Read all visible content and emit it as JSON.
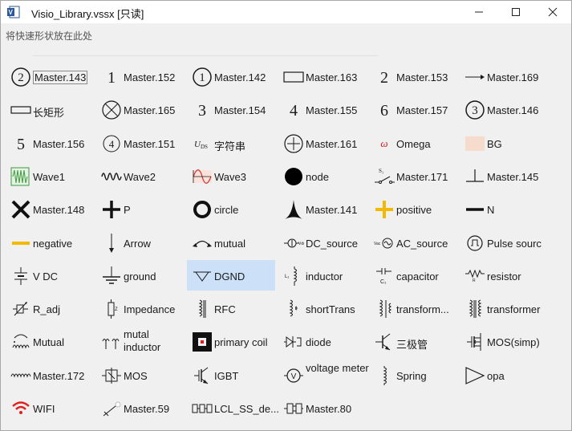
{
  "window": {
    "title": "Visio_Library.vssx  [只读]"
  },
  "hint_text": "将快速形状放在此处",
  "shapes": [
    {
      "label": "Master.143",
      "icon": "circled-two-icon"
    },
    {
      "label": "Master.152",
      "icon": "numeral-one-icon"
    },
    {
      "label": "Master.142",
      "icon": "circled-one-icon"
    },
    {
      "label": "Master.163",
      "icon": "rectangle-icon"
    },
    {
      "label": "Master.153",
      "icon": "numeral-two-icon"
    },
    {
      "label": "Master.169",
      "icon": "arrow-right-icon"
    },
    {
      "label": "长矩形",
      "icon": "long-rectangle-icon"
    },
    {
      "label": "Master.165",
      "icon": "circle-cross-icon"
    },
    {
      "label": "Master.154",
      "icon": "numeral-three-icon"
    },
    {
      "label": "Master.155",
      "icon": "numeral-four-icon"
    },
    {
      "label": "Master.157",
      "icon": "numeral-six-icon"
    },
    {
      "label": "Master.146",
      "icon": "circled-three-icon"
    },
    {
      "label": "Master.156",
      "icon": "numeral-five-icon"
    },
    {
      "label": "Master.151",
      "icon": "circled-four-icon"
    },
    {
      "label": "字符串",
      "icon": "uds-text-icon"
    },
    {
      "label": "Master.161",
      "icon": "circle-plus-icon"
    },
    {
      "label": "Omega",
      "icon": "omega-icon"
    },
    {
      "label": "BG",
      "icon": "bg-swatch-icon"
    },
    {
      "label": "Wave1",
      "icon": "wave1-icon"
    },
    {
      "label": "Wave2",
      "icon": "wave2-icon"
    },
    {
      "label": "Wave3",
      "icon": "wave3-icon"
    },
    {
      "label": "node",
      "icon": "node-dot-icon"
    },
    {
      "label": "Master.171",
      "icon": "switch-icon"
    },
    {
      "label": "Master.145",
      "icon": "ground-tee-icon"
    },
    {
      "label": "Master.148",
      "icon": "bold-x-icon"
    },
    {
      "label": "P",
      "icon": "bold-plus-icon"
    },
    {
      "label": "circle",
      "icon": "ring-icon"
    },
    {
      "label": "Master.141",
      "icon": "spike-icon"
    },
    {
      "label": "positive",
      "icon": "yellow-plus-icon"
    },
    {
      "label": "N",
      "icon": "bold-minus-icon"
    },
    {
      "label": "negative",
      "icon": "yellow-minus-icon"
    },
    {
      "label": "Arrow",
      "icon": "arrow-down-icon"
    },
    {
      "label": "mutual",
      "icon": "mutual-arc-icon"
    },
    {
      "label": "DC_source",
      "icon": "dc-source-icon"
    },
    {
      "label": "AC_source",
      "icon": "ac-source-icon"
    },
    {
      "label": "Pulse sourc",
      "icon": "pulse-source-icon"
    },
    {
      "label": "V DC",
      "icon": "vdc-icon"
    },
    {
      "label": "ground",
      "icon": "ground-icon"
    },
    {
      "label": "DGND",
      "icon": "dgnd-icon"
    },
    {
      "label": "inductor",
      "icon": "inductor-icon"
    },
    {
      "label": "capacitor",
      "icon": "capacitor-icon"
    },
    {
      "label": "resistor",
      "icon": "resistor-icon"
    },
    {
      "label": "R_adj",
      "icon": "r-adj-icon"
    },
    {
      "label": "Impedance",
      "icon": "impedance-icon"
    },
    {
      "label": "RFC",
      "icon": "rfc-icon"
    },
    {
      "label": "shortTrans",
      "icon": "short-trans-icon"
    },
    {
      "label": "transform...",
      "icon": "transform-icon"
    },
    {
      "label": "transformer",
      "icon": "transformer-icon"
    },
    {
      "label": "Mutual",
      "icon": "mutual-coil-icon"
    },
    {
      "label": "mutal inductor",
      "icon": "mutal-inductor-icon"
    },
    {
      "label": "primary coil",
      "icon": "primary-coil-icon"
    },
    {
      "label": "diode",
      "icon": "diode-icon"
    },
    {
      "label": "三极管",
      "icon": "transistor-icon"
    },
    {
      "label": "MOS(simp)",
      "icon": "mos-simp-icon"
    },
    {
      "label": "Master.172",
      "icon": "coil-line-icon"
    },
    {
      "label": "MOS",
      "icon": "mos-icon"
    },
    {
      "label": "IGBT",
      "icon": "igbt-icon"
    },
    {
      "label": "voltage meter",
      "icon": "voltmeter-icon"
    },
    {
      "label": "Spring",
      "icon": "spring-icon"
    },
    {
      "label": "opa",
      "icon": "opamp-icon"
    },
    {
      "label": "WIFI",
      "icon": "wifi-icon"
    },
    {
      "label": "Master.59",
      "icon": "pen-icon"
    },
    {
      "label": "LCL_SS_de...",
      "icon": "lcl-icon"
    },
    {
      "label": "Master.80",
      "icon": "master80-icon"
    }
  ],
  "selected_label": "DGND",
  "colors": {
    "selection": "#cce0f7",
    "accent_yellow": "#f2b900",
    "wifi_red": "#e02020",
    "wave_green": "#3a9a3a",
    "bg_swatch": "#f6dccd"
  }
}
